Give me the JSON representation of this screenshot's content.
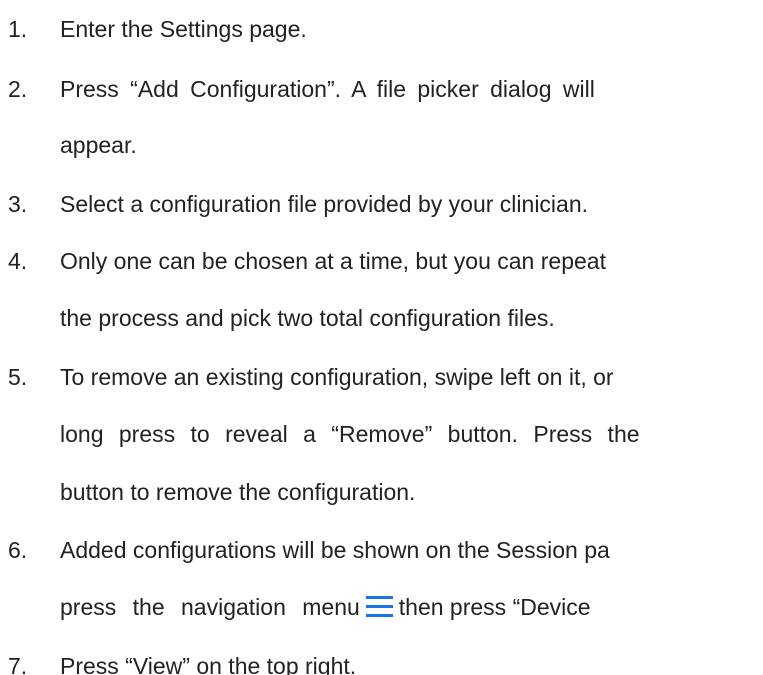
{
  "steps": [
    {
      "number": "1.",
      "lines": [
        "Enter the Settings page."
      ]
    },
    {
      "number": "2.",
      "lines": [
        "Press “Add Configuration”. A file picker dialog will",
        "appear."
      ]
    },
    {
      "number": "3.",
      "lines": [
        "Select a configuration file provided by your clinician."
      ]
    },
    {
      "number": "4.",
      "lines": [
        "Only one can be chosen at a time, but you can repeat",
        "the process and pick two total configuration files."
      ]
    },
    {
      "number": "5.",
      "lines": [
        "To remove an existing configuration, swipe left on it, or",
        "long press to reveal a “Remove” button. Press the",
        "button to remove the configuration."
      ]
    },
    {
      "number": "6.",
      "lines": [
        "Added configurations will be shown on the Session pa",
        "press the navigation menu",
        "then press “Device"
      ]
    },
    {
      "number": "7.",
      "lines": [
        "Press “View” on the top right."
      ]
    }
  ],
  "icons": {
    "navigation_menu": "hamburger-menu-icon",
    "navigation_menu_color": "#1a73e8"
  }
}
